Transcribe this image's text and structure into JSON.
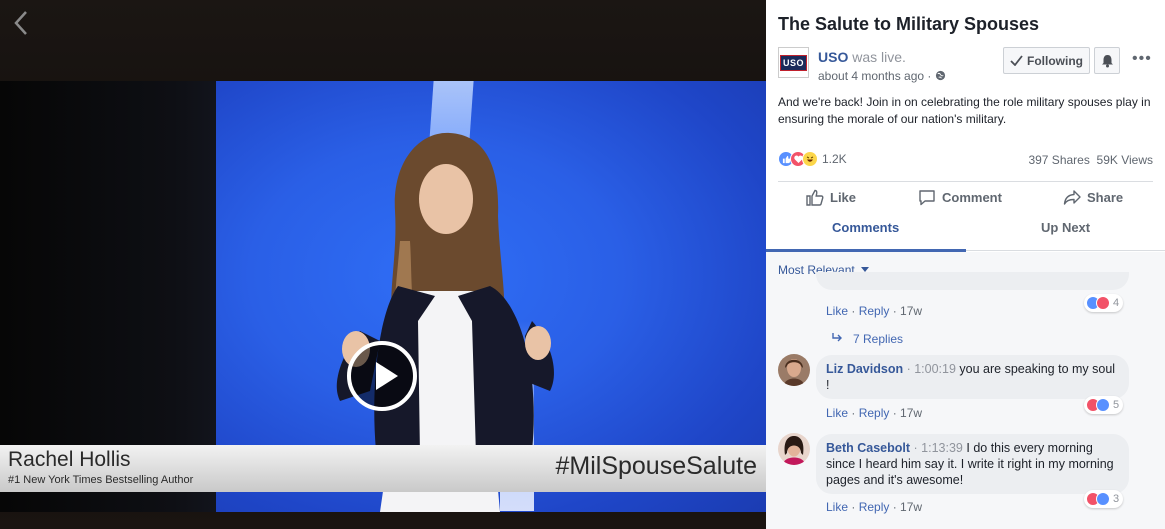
{
  "video": {
    "speaker_name": "Rachel Hollis",
    "speaker_title": "#1 New York Times Bestselling Author",
    "hashtag": "#MilSpouseSalute"
  },
  "post": {
    "title": "The Salute to Military Spouses",
    "page_logo_text": "USO",
    "author": "USO",
    "author_suffix": " was live.",
    "time": "about 4 months ago · ",
    "follow_label": "Following",
    "more_label": "•••",
    "text": "And we're back! Join in on celebrating the role military spouses play in ensuring the morale of our nation's military.",
    "reaction_count": "1.2K",
    "shares": "397 Shares",
    "views": "59K Views",
    "actions": {
      "like": "Like",
      "comment": "Comment",
      "share": "Share"
    }
  },
  "tabs": {
    "comments": "Comments",
    "up_next": "Up Next"
  },
  "comments": {
    "sort_label": "Most Relevant",
    "sort_icon": "caret-down-icon",
    "partial": {
      "like": "Like",
      "reply": "Reply",
      "time": "17w",
      "reactions": "4"
    },
    "replies_label": "7 Replies",
    "items": [
      {
        "name": "Liz Davidson",
        "timestamp": "1:00:19",
        "text": "you are speaking to my soul !",
        "like": "Like",
        "reply": "Reply",
        "time": "17w",
        "reactions": "5"
      },
      {
        "name": "Beth Casebolt",
        "timestamp": "1:13:39",
        "text": "I do this every morning since I heard him say it. I write it right in my morning pages and it's awesome!",
        "like": "Like",
        "reply": "Reply",
        "time": "17w",
        "reactions": "3"
      }
    ]
  },
  "colors": {
    "link": "#365899",
    "accent": "#4267b2",
    "like_blue": "#5890ff",
    "love_red": "#f25268",
    "haha_yellow": "#fcd64a",
    "stage_blue": "#2a5fe6"
  }
}
